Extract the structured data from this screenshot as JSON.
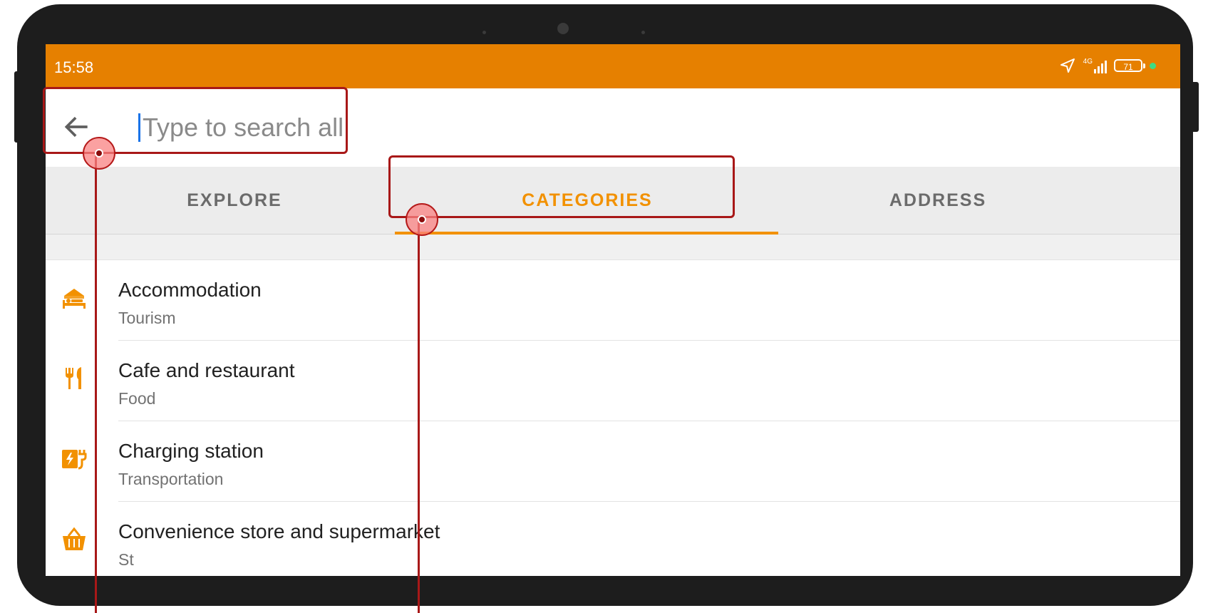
{
  "status_bar": {
    "time": "15:58",
    "network": "4G",
    "battery": "71",
    "background_color": "#e68000"
  },
  "search": {
    "placeholder": "Type to search all",
    "value": ""
  },
  "tabs": [
    {
      "label": "EXPLORE",
      "active": false
    },
    {
      "label": "CATEGORIES",
      "active": true
    },
    {
      "label": "ADDRESS",
      "active": false
    }
  ],
  "accent_color": "#f29100",
  "categories": [
    {
      "title": "Accommodation",
      "subtitle": "Tourism",
      "icon": "hotel-bed-icon"
    },
    {
      "title": "Cafe and restaurant",
      "subtitle": "Food",
      "icon": "fork-knife-icon"
    },
    {
      "title": "Charging station",
      "subtitle": "Transportation",
      "icon": "ev-charging-icon"
    },
    {
      "title": "Convenience store and supermarket",
      "subtitle": "St",
      "icon": "shopping-basket-icon"
    }
  ]
}
